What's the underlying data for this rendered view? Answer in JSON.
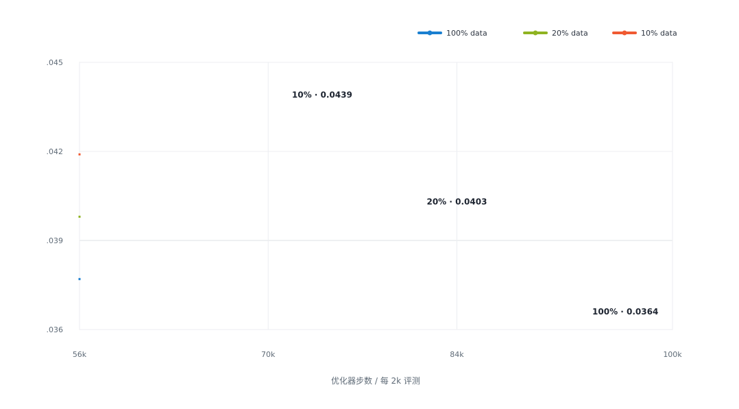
{
  "chart_data": {
    "type": "line",
    "title": "",
    "xlabel": "优化器步数 / 每 2k 评测",
    "ylabel": "",
    "x_ticks": [
      {
        "value": 56000,
        "label": "56k"
      },
      {
        "value": 70000,
        "label": "70k"
      },
      {
        "value": 84000,
        "label": "84k"
      },
      {
        "value": 100000,
        "label": "100k"
      }
    ],
    "y_ticks": [
      {
        "value": 0.036,
        "label": ".036"
      },
      {
        "value": 0.039,
        "label": ".039"
      },
      {
        "value": 0.042,
        "label": ".042"
      },
      {
        "value": 0.045,
        "label": ".045"
      }
    ],
    "xlim": [
      56000,
      100000
    ],
    "ylim": [
      0.036,
      0.045
    ],
    "grid": true,
    "legend_position": "top-right",
    "series": [
      {
        "name": "100% data",
        "color": "#1a7fd0",
        "x": [
          56000
        ],
        "y": [
          0.0377
        ]
      },
      {
        "name": "20% data",
        "color": "#8fb321",
        "x": [
          56000
        ],
        "y": [
          0.0398
        ]
      },
      {
        "name": "10% data",
        "color": "#f05a32",
        "x": [
          56000
        ],
        "y": [
          0.0419
        ]
      }
    ],
    "annotations": [
      {
        "text": "10% · 0.0439",
        "x": 74000,
        "y": 0.0439
      },
      {
        "text": "20% · 0.0403",
        "x": 84000,
        "y": 0.0403
      },
      {
        "text": "100% · 0.0364",
        "x": 96500,
        "y": 0.0366
      }
    ]
  }
}
